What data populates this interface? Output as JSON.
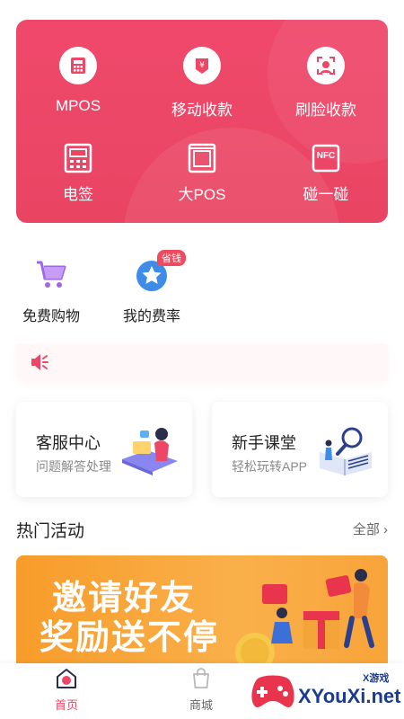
{
  "functions": {
    "row1": [
      {
        "label": "MPOS",
        "icon": "calculator-icon"
      },
      {
        "label": "移动收款",
        "icon": "wallet-icon"
      },
      {
        "label": "刷脸收款",
        "icon": "face-scan-icon"
      }
    ],
    "row2": [
      {
        "label": "电签",
        "icon": "pos-terminal-icon"
      },
      {
        "label": "大POS",
        "icon": "big-pos-icon"
      },
      {
        "label": "碰一碰",
        "icon": "nfc-icon",
        "badge_text": "NFC"
      }
    ]
  },
  "shortcuts": [
    {
      "label": "免费购物",
      "icon": "cart-icon"
    },
    {
      "label": "我的费率",
      "icon": "star-icon",
      "badge": "省钱"
    }
  ],
  "notice": {
    "icon": "speaker-icon",
    "text": ""
  },
  "cards": [
    {
      "title": "客服中心",
      "subtitle": "问题解答处理"
    },
    {
      "title": "新手课堂",
      "subtitle": "轻松玩转APP"
    }
  ],
  "hot": {
    "title": "热门活动",
    "all_label": "全部 ›",
    "banner_line1": "邀请好友",
    "banner_line2": "奖励送不停"
  },
  "tabs": [
    {
      "label": "首页",
      "active": true
    },
    {
      "label": "商城",
      "active": false
    }
  ],
  "watermark": {
    "main": "XYouXi.net",
    "small": "X游戏"
  },
  "colors": {
    "primary": "#ec4767",
    "banner": "#f8a43a",
    "watermark": "#1a3d8f"
  }
}
